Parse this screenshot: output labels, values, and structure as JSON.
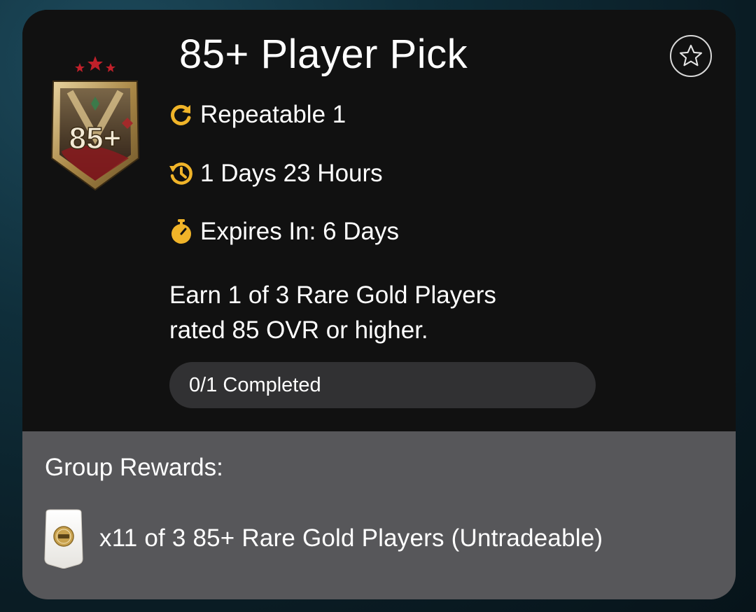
{
  "objective": {
    "title": "85+ Player Pick",
    "badge_text": "85+",
    "repeatable_text": "Repeatable 1",
    "time_remaining_text": "1 Days 23 Hours",
    "expires_text": "Expires In: 6 Days",
    "description_line1": "Earn 1 of 3 Rare Gold Players",
    "description_line2": "rated 85 OVR or higher.",
    "progress": {
      "label": "0/1 Completed",
      "completed": 0,
      "total": 1
    }
  },
  "rewards": {
    "heading": "Group Rewards:",
    "items": [
      {
        "text": "x11 of 3 85+ Rare Gold Players (Untradeable)",
        "icon": "player-pack-card-icon"
      }
    ]
  },
  "icons": {
    "repeat": "refresh-icon",
    "timer": "history-clock-icon",
    "expires": "stopwatch-icon",
    "favorite": "star-outline-icon"
  },
  "colors": {
    "accent": "#f0b429",
    "card_top": "#111111",
    "card_bottom": "#57575a",
    "progress_track": "#313133"
  }
}
